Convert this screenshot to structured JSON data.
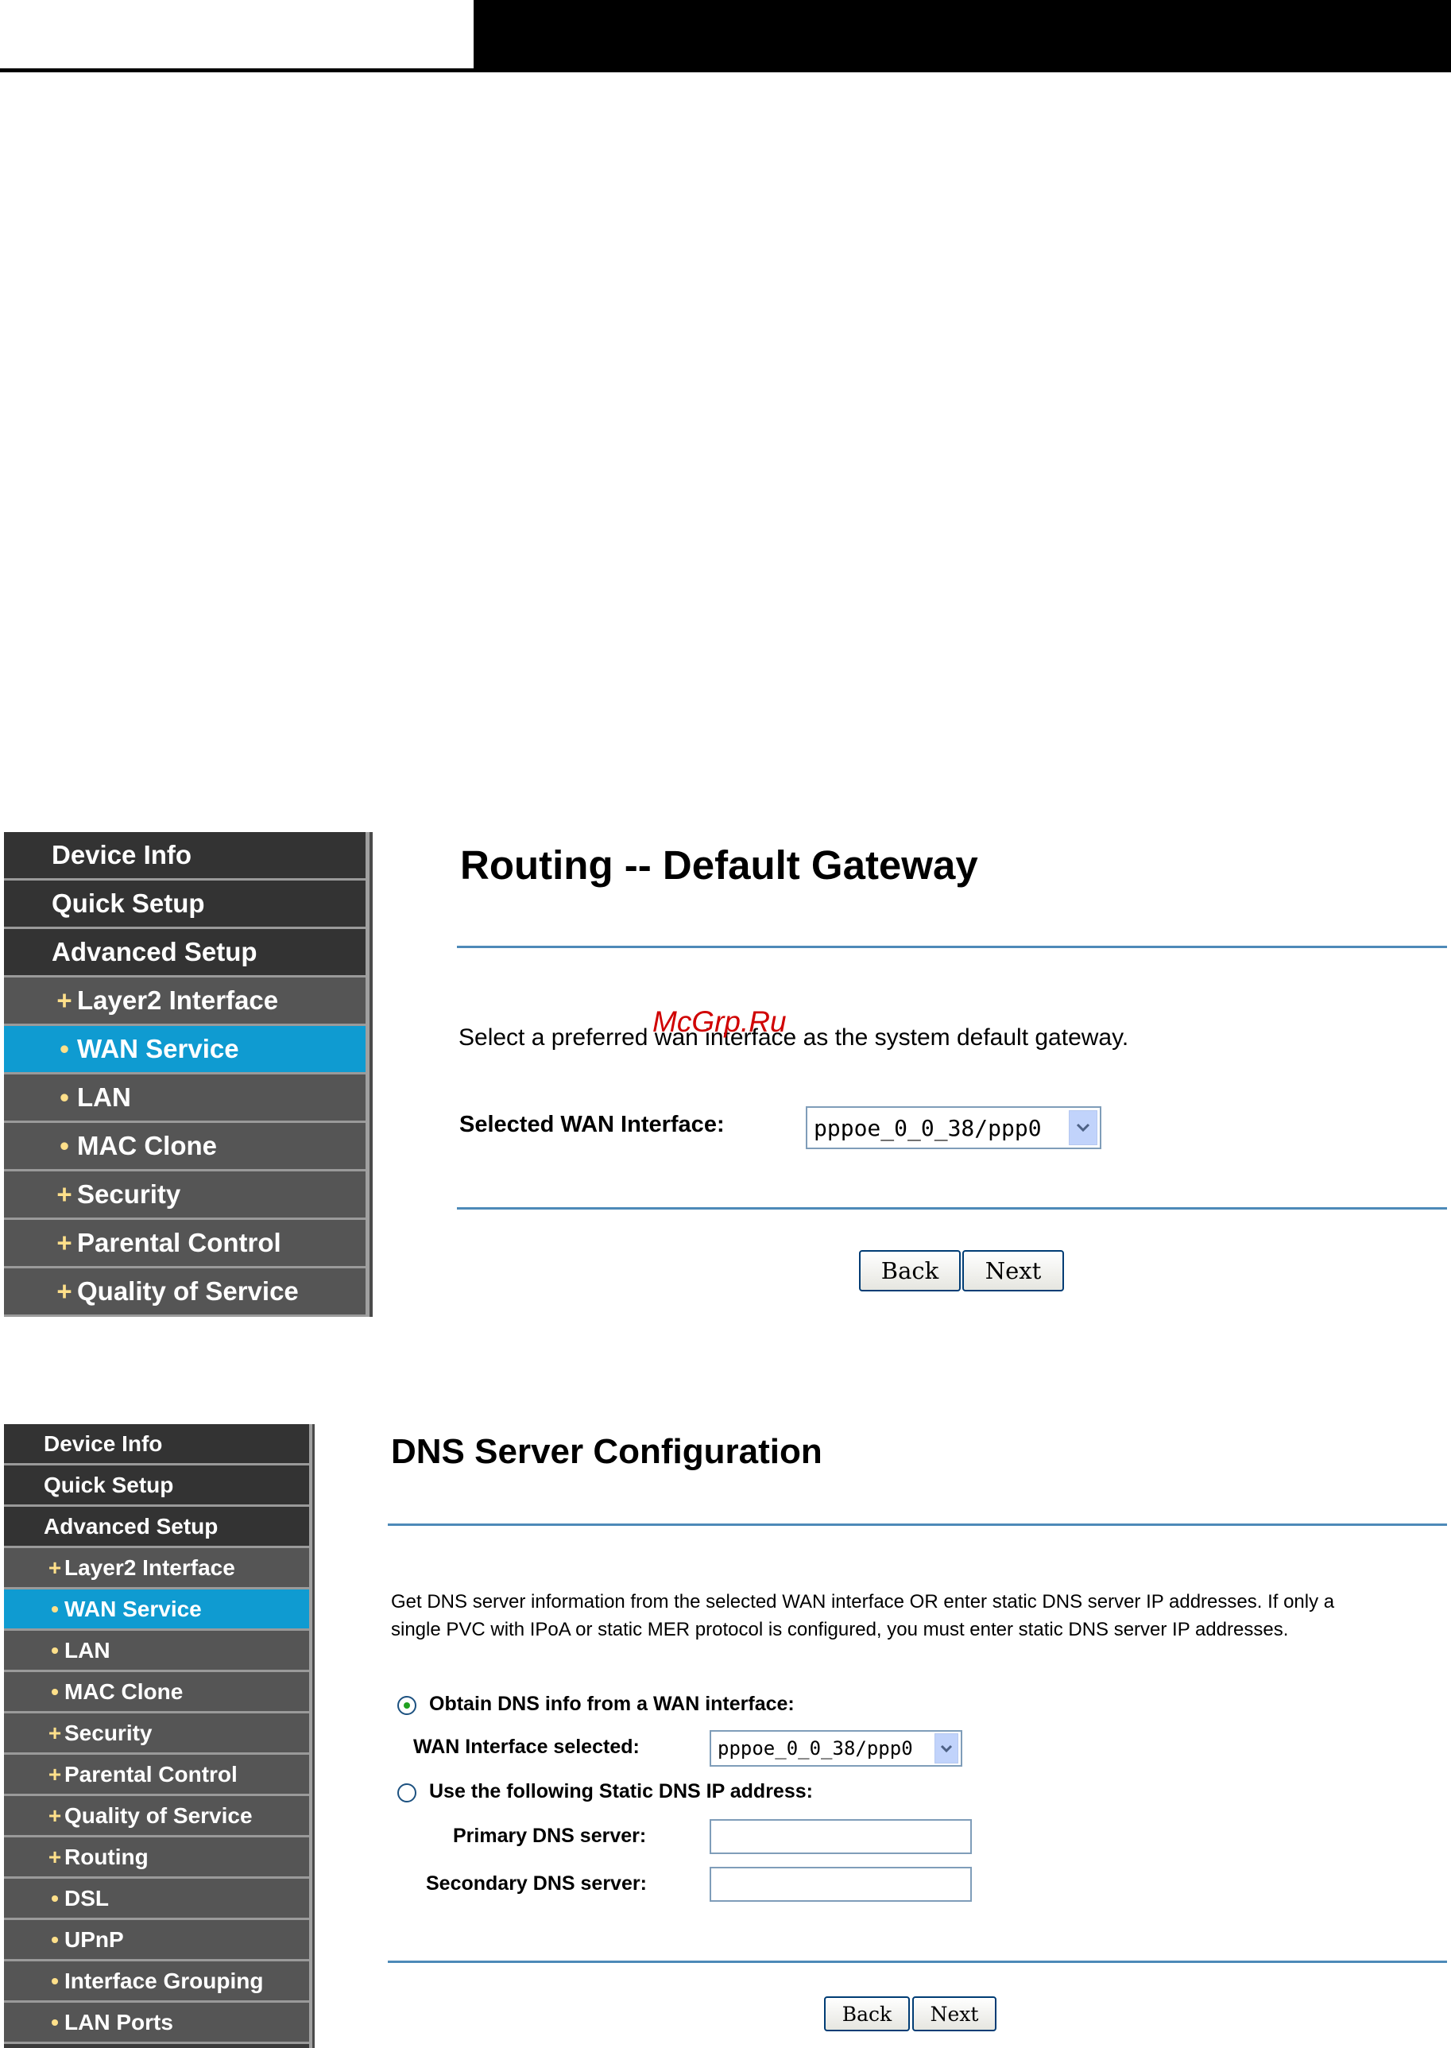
{
  "panel1": {
    "sidebar": [
      {
        "label": "Device Info",
        "bullet": "",
        "level": "top"
      },
      {
        "label": "Quick Setup",
        "bullet": "",
        "level": "top"
      },
      {
        "label": "Advanced Setup",
        "bullet": "",
        "level": "top"
      },
      {
        "label": "Layer2 Interface",
        "bullet": "+",
        "level": "sub"
      },
      {
        "label": "WAN Service",
        "bullet": "•",
        "level": "sub",
        "active": true
      },
      {
        "label": "LAN",
        "bullet": "•",
        "level": "sub"
      },
      {
        "label": "MAC Clone",
        "bullet": "•",
        "level": "sub"
      },
      {
        "label": "Security",
        "bullet": "+",
        "level": "sub"
      },
      {
        "label": "Parental Control",
        "bullet": "+",
        "level": "sub"
      },
      {
        "label": "Quality of Service",
        "bullet": "+",
        "level": "sub"
      }
    ],
    "title": "Routing -- Default Gateway",
    "description": "Select a preferred wan interface as the system default gateway.",
    "watermark": "McGrp.Ru",
    "wan_label": "Selected WAN Interface:",
    "wan_value": "pppoe_0_0_38/ppp0",
    "back_label": "Back",
    "next_label": "Next"
  },
  "panel2": {
    "sidebar": [
      {
        "label": "Device Info",
        "bullet": "",
        "level": "top"
      },
      {
        "label": "Quick Setup",
        "bullet": "",
        "level": "top"
      },
      {
        "label": "Advanced Setup",
        "bullet": "",
        "level": "top"
      },
      {
        "label": "Layer2 Interface",
        "bullet": "+",
        "level": "sub"
      },
      {
        "label": "WAN Service",
        "bullet": "•",
        "level": "sub",
        "active": true
      },
      {
        "label": "LAN",
        "bullet": "•",
        "level": "sub"
      },
      {
        "label": "MAC Clone",
        "bullet": "•",
        "level": "sub"
      },
      {
        "label": "Security",
        "bullet": "+",
        "level": "sub"
      },
      {
        "label": "Parental Control",
        "bullet": "+",
        "level": "sub"
      },
      {
        "label": "Quality of Service",
        "bullet": "+",
        "level": "sub"
      },
      {
        "label": "Routing",
        "bullet": "+",
        "level": "sub"
      },
      {
        "label": "DSL",
        "bullet": "•",
        "level": "sub"
      },
      {
        "label": "UPnP",
        "bullet": "•",
        "level": "sub"
      },
      {
        "label": "Interface Grouping",
        "bullet": "•",
        "level": "sub"
      },
      {
        "label": "LAN Ports",
        "bullet": "•",
        "level": "sub"
      }
    ],
    "title": "DNS Server Configuration",
    "description_line1": "Get DNS server information from the selected WAN interface OR enter static DNS server IP addresses. If only a",
    "description_line2": "single PVC with IPoA or static MER protocol is configured, you must enter static DNS server IP addresses.",
    "radio_obtain_label": "Obtain DNS info from a WAN interface:",
    "radio_obtain_checked": true,
    "wan_selected_label": "WAN Interface selected:",
    "wan_selected_value": "pppoe_0_0_38/ppp0",
    "radio_static_label": "Use the following Static DNS IP address:",
    "radio_static_checked": false,
    "primary_dns_label": "Primary DNS server:",
    "primary_dns_value": "",
    "secondary_dns_label": "Secondary DNS server:",
    "secondary_dns_value": "",
    "back_label": "Back",
    "next_label": "Next"
  }
}
